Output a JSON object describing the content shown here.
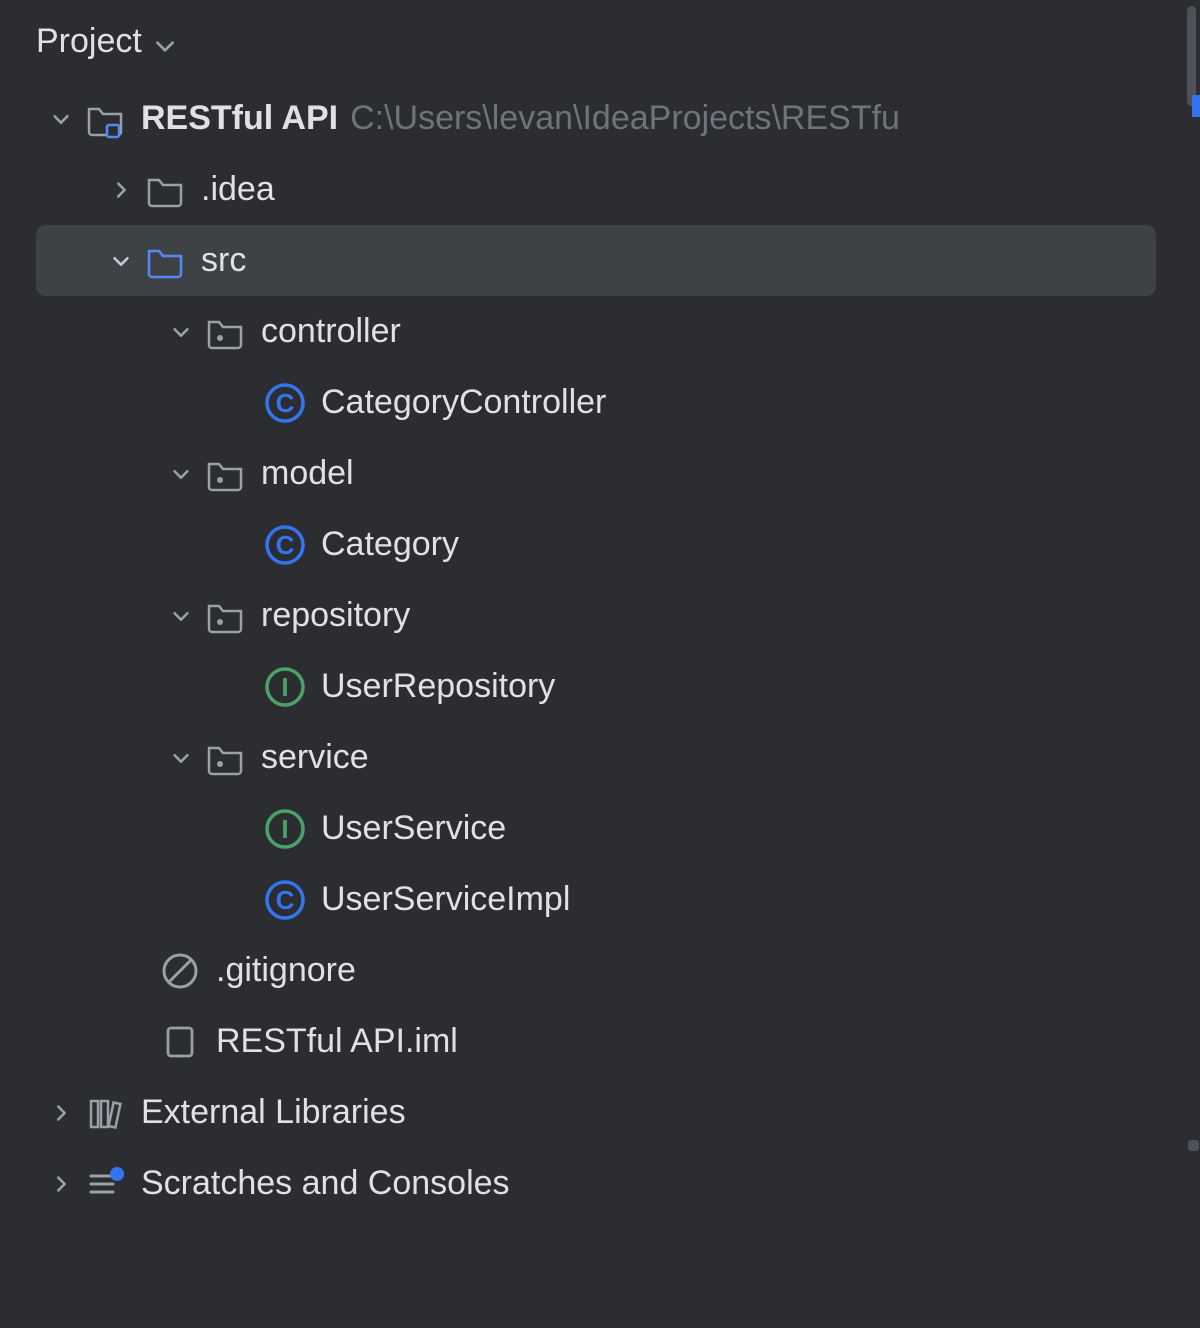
{
  "header": {
    "title": "Project"
  },
  "root": {
    "name": "RESTful API",
    "path": "C:\\Users\\levan\\IdeaProjects\\RESTfu",
    "idea_folder": ".idea",
    "src_folder": "src",
    "packages": {
      "controller": {
        "name": "controller",
        "classes": [
          "CategoryController"
        ]
      },
      "model": {
        "name": "model",
        "classes": [
          "Category"
        ]
      },
      "repository": {
        "name": "repository",
        "interfaces": [
          "UserRepository"
        ]
      },
      "service": {
        "name": "service",
        "interfaces": [
          "UserService"
        ],
        "classes": [
          "UserServiceImpl"
        ]
      }
    },
    "files": {
      "gitignore": ".gitignore",
      "iml": "RESTful API.iml"
    }
  },
  "library_nodes": {
    "external": "External Libraries",
    "scratches": "Scratches and Consoles"
  }
}
